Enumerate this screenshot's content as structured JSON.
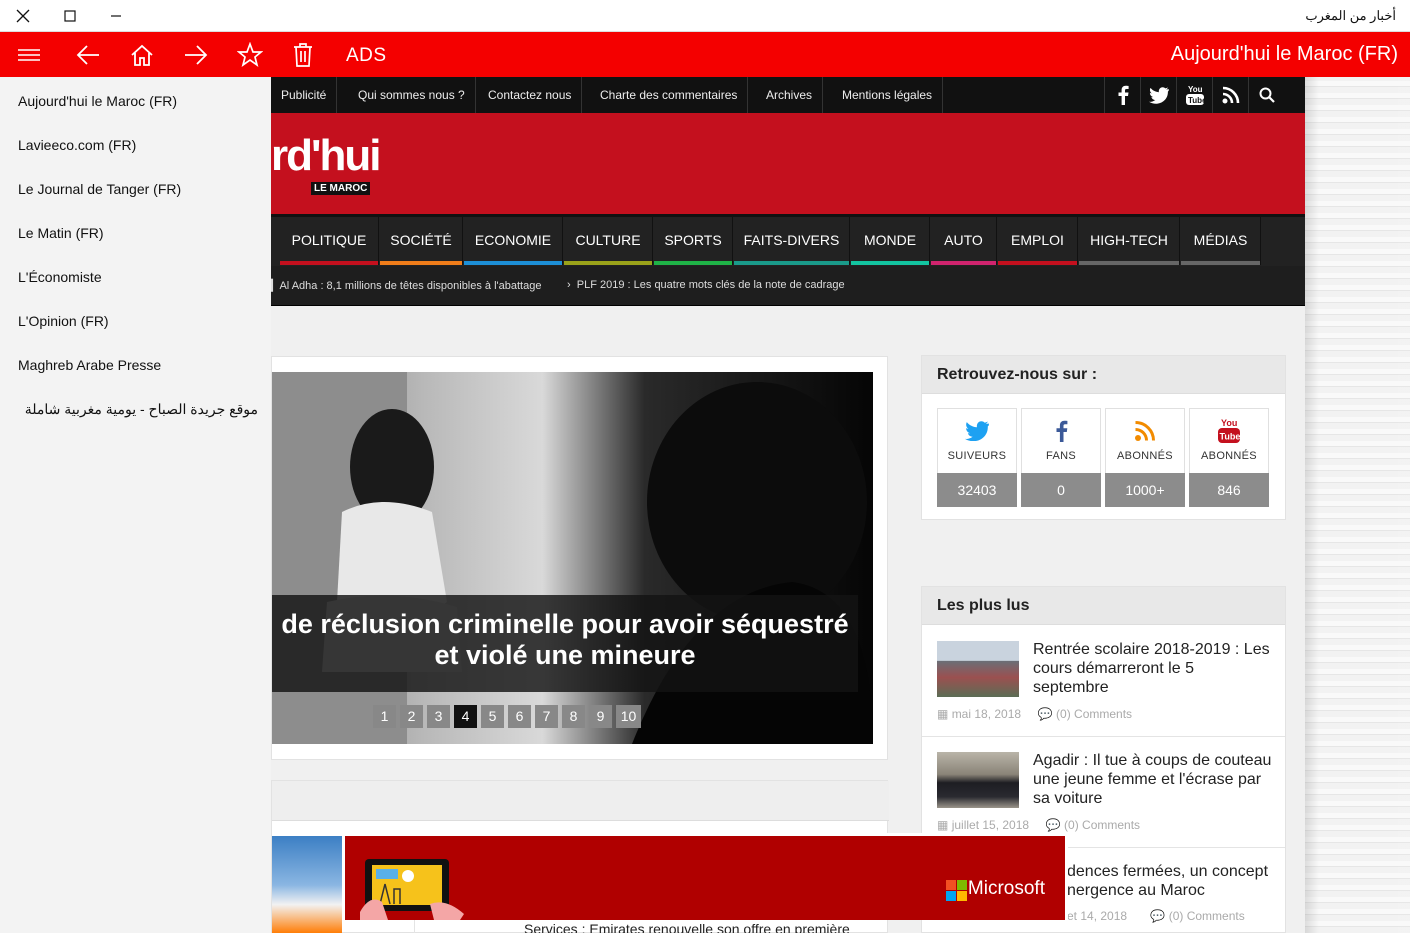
{
  "window": {
    "title": "أخبار من المغرب",
    "close": "✕",
    "maximize": "☐",
    "minimize": "–"
  },
  "toolbar": {
    "ads_label": "ADS",
    "site_title": "Aujourd'hui le Maroc (FR)"
  },
  "sidebar": {
    "items": [
      "Aujourd'hui le Maroc (FR)",
      "Lavieeco.com (FR)",
      "Le Journal de Tanger (FR)",
      "Le Matin (FR)",
      "L'Économiste",
      "L'Opinion (FR)",
      "Maghreb Arabe Presse",
      "موقع جريدة الصباح - يومية مغربية شاملة"
    ]
  },
  "topnav": [
    "Publicité",
    "Qui sommes nous ?",
    "Contactez nous",
    "Charte des commentaires",
    "Archives",
    "Mentions légales"
  ],
  "logo": {
    "text": "rd'hui",
    "sub": "LE MAROC"
  },
  "categories": [
    {
      "label": "POLITIQUE",
      "color": "#c4101e"
    },
    {
      "label": "SOCIÉTÉ",
      "color": "#f07d1a"
    },
    {
      "label": "ECONOMIE",
      "color": "#1d8fd6"
    },
    {
      "label": "CULTURE",
      "color": "#9aa21a"
    },
    {
      "label": "SPORTS",
      "color": "#1fb347"
    },
    {
      "label": "FAITS-DIVERS",
      "color": "#1a9a8a"
    },
    {
      "label": "MONDE",
      "color": "#13c4a0"
    },
    {
      "label": "AUTO",
      "color": "#d0246e"
    },
    {
      "label": "EMPLOI",
      "color": "#c4101e"
    },
    {
      "label": "HIGH-TECH",
      "color": "#666666"
    },
    {
      "label": "MÉDIAS",
      "color": "#666666"
    }
  ],
  "ticker": [
    "Al Adha : 8,1 millions de têtes disponibles à l'abattage",
    "PLF 2019 : Les quatre mots clés de la note de cadrage"
  ],
  "slider": {
    "caption_line1": "de réclusion criminelle pour avoir séquestré",
    "caption_line2": "et violé une mineure",
    "pages": [
      "1",
      "2",
      "3",
      "4",
      "5",
      "6",
      "7",
      "8",
      "9",
      "10"
    ],
    "active_page": "4"
  },
  "box2": {
    "text": "Services : Emirates renouvelle son offre en première"
  },
  "follow": {
    "title": "Retrouvez-nous sur :",
    "items": [
      {
        "label": "SUIVEURS",
        "count": "32403",
        "icon": "twitter-icon"
      },
      {
        "label": "FANS",
        "count": "0",
        "icon": "facebook-icon"
      },
      {
        "label": "ABONNÉS",
        "count": "1000+",
        "icon": "rss-icon"
      },
      {
        "label": "ABONNÉS",
        "count": "846",
        "icon": "youtube-icon"
      }
    ]
  },
  "popular": {
    "title": "Les plus lus",
    "items": [
      {
        "title": "Rentrée scolaire 2018-2019 : Les cours démarreront le 5 septembre",
        "date": "mai 18, 2018",
        "comments": "(0) Comments"
      },
      {
        "title": "Agadir : Il tue à coups de couteau une jeune femme et l'écrase par sa voiture",
        "date": "juillet 15, 2018",
        "comments": "(0) Comments"
      },
      {
        "title": "dences fermées, un concept nergence au Maroc",
        "date": "et 14, 2018",
        "comments": "(0) Comments"
      }
    ]
  },
  "ad": {
    "brand": "Microsoft"
  },
  "colors": {
    "toolbar": "#f40000",
    "header": "#c4101e",
    "ad": "#b00000"
  }
}
